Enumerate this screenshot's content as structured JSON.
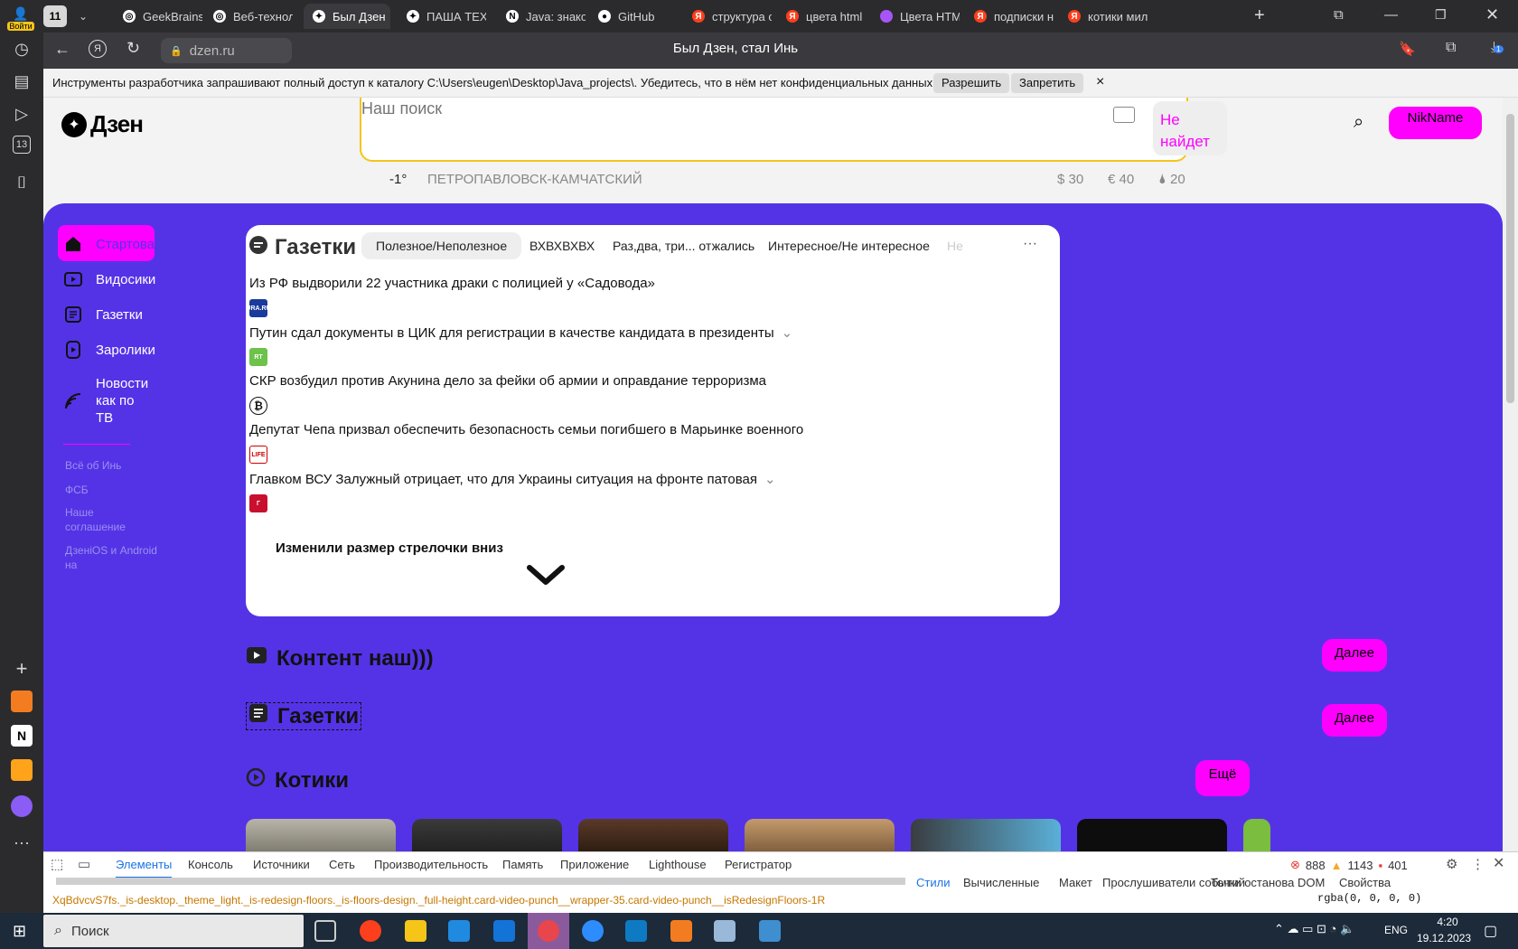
{
  "browser": {
    "profile_label": "Войти",
    "tab_count": "11",
    "tabs": [
      {
        "label": "GeekBrains",
        "icon": "geekbrains-icon",
        "color": "#ffffff"
      },
      {
        "label": "Веб-технол",
        "icon": "geekbrains-icon",
        "color": "#ffffff"
      },
      {
        "label": "Был Дзен",
        "icon": "dzen-icon",
        "color": "#ffffff"
      },
      {
        "label": "ПАША ТЕХ",
        "icon": "dzen-icon",
        "color": "#ffffff"
      },
      {
        "label": "Java: знаком",
        "icon": "notion-icon",
        "color": "#ffffff"
      },
      {
        "label": "GitHub",
        "icon": "github-icon",
        "color": "#ffffff"
      },
      {
        "label": "структура с",
        "icon": "yandex-icon",
        "color": "#fc3f1d"
      },
      {
        "label": "цвета html",
        "icon": "yandex-icon",
        "color": "#fc3f1d"
      },
      {
        "label": "Цвета HTML",
        "icon": "color-wheel-icon",
        "color": "#a855f7"
      },
      {
        "label": "подписки н",
        "icon": "yandex-icon",
        "color": "#fc3f1d"
      },
      {
        "label": "котики мил",
        "icon": "yandex-icon",
        "color": "#fc3f1d"
      }
    ],
    "url": "dzen.ru",
    "page_title": "Был Дзен, стал Инь",
    "download_badge": "1",
    "rail_badge": "13"
  },
  "devtools_prompt": {
    "message": "Инструменты разработчика запрашивают полный доступ к каталогу C:\\Users\\eugen\\Desktop\\Java_projects\\. Убедитесь, что в нём нет конфиденциальных данных.",
    "allow": "Разрешить",
    "deny": "Запретить",
    "close": "×"
  },
  "header": {
    "logo": "Дзен",
    "search_placeholder": "Наш поиск",
    "search_button": "Не найдет",
    "username": "NikName",
    "weather": "-1°",
    "city": "ПЕТРОПАВЛОВСК-КАМЧАТСКИЙ",
    "usd": "$ 30",
    "eur": "€ 40",
    "oil": "20"
  },
  "sidebar": {
    "items": [
      {
        "label": "Стартовая"
      },
      {
        "label": "Видосики"
      },
      {
        "label": "Газетки"
      },
      {
        "label": "Заролики"
      },
      {
        "label": "Новости как по ТВ"
      }
    ],
    "footer": [
      "Всё об Инь",
      "ФСБ",
      "Наше соглашение",
      "ДзенiOS и Android на"
    ]
  },
  "news_card": {
    "title": "Газетки",
    "chips": [
      "Полезное/Неполезное",
      "ВХВХВХВХ",
      "Раз,два, три... отжались",
      "Интересное/Не интересное",
      "Не"
    ],
    "more": "···",
    "items": [
      {
        "text": "Из РФ выдворили 22 участника драки с полицией у «Садовода»",
        "source": "URA.RU",
        "color": "#1a3a9c"
      },
      {
        "text": "Путин сдал документы в ЦИК для регистрации в качестве кандидата в президенты",
        "source": "RT",
        "color": "#6cc24a"
      },
      {
        "text": "СКР возбудил против Акунина дело за фейки об армии и оправдание терроризма",
        "source": "",
        "color": "#ffffff"
      },
      {
        "text": "Депутат Чепа призвал обеспечить безопасность семьи погибшего в Марьинке военного",
        "source": "LIFE",
        "color": "#ffffff"
      },
      {
        "text": "Главком ВСУ Залужный отрицает, что для Украины ситуация на фронте патовая",
        "source": "Г",
        "color": "#c8102e"
      }
    ],
    "arrow_caption": "Изменили размер стрелочки вниз"
  },
  "sections": [
    {
      "title": "Контент наш)))",
      "button": "Далее"
    },
    {
      "title": "Газетки",
      "button": "Далее"
    },
    {
      "title": "Котики",
      "button": "Ещё"
    }
  ],
  "devtools": {
    "tabs": [
      "Элементы",
      "Консоль",
      "Источники",
      "Сеть",
      "Производительность",
      "Память",
      "Приложение",
      "Lighthouse",
      "Регистратор"
    ],
    "errors": "888",
    "warnings": "1143",
    "issues": "401",
    "breadcrumb": "XqBdvcvS7fs._is-desktop._theme_light._is-redesign-floors._is-floors-design._full-height.card-video-punch__wrapper-35.card-video-punch__isRedesignFloors-1R",
    "side_tabs": [
      "Стили",
      "Вычисленные",
      "Макет",
      "Прослушиватели событий",
      "Точки останова DOM",
      "Свойства"
    ],
    "style_value": "rgba(0, 0, 0, 0)"
  },
  "taskbar": {
    "search": "Поиск",
    "lang": "ENG",
    "time": "4:20",
    "date": "19.12.2023"
  }
}
